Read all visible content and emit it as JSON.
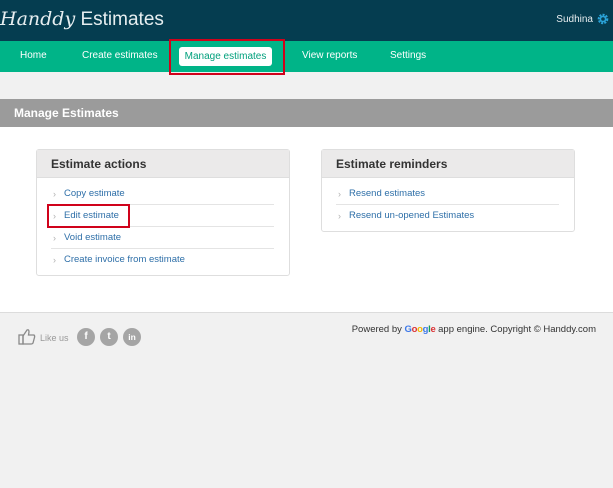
{
  "header": {
    "logo_script": "Handdy",
    "logo_plain": "Estimates",
    "user_name": "Sudhina"
  },
  "nav": {
    "items": [
      {
        "label": "Home"
      },
      {
        "label": "Create estimates"
      },
      {
        "label": "Manage estimates",
        "active": true
      },
      {
        "label": "View reports"
      },
      {
        "label": "Settings"
      }
    ]
  },
  "page": {
    "title": "Manage Estimates"
  },
  "estimate_actions": {
    "title": "Estimate actions",
    "items": [
      {
        "label": "Copy estimate"
      },
      {
        "label": "Edit estimate"
      },
      {
        "label": "Void estimate"
      },
      {
        "label": "Create invoice from estimate"
      }
    ]
  },
  "estimate_reminders": {
    "title": "Estimate reminders",
    "items": [
      {
        "label": "Resend estimates"
      },
      {
        "label": "Resend un-opened Estimates"
      }
    ]
  },
  "footer": {
    "like_text": "Like us",
    "social": [
      {
        "icon": "facebook-icon",
        "glyph": "f"
      },
      {
        "icon": "twitter-icon",
        "glyph": "t"
      },
      {
        "icon": "linkedin-icon",
        "glyph": "in"
      }
    ],
    "powered_prefix": "Powered by",
    "google": [
      "G",
      "o",
      "o",
      "g",
      "l",
      "e"
    ],
    "powered_suffix": "app engine. Copyright © Handdy.com"
  },
  "colors": {
    "header_bg": "#053d50",
    "nav_bg": "#00b488",
    "link": "#2e6fa8",
    "highlight": "#d0021b"
  }
}
